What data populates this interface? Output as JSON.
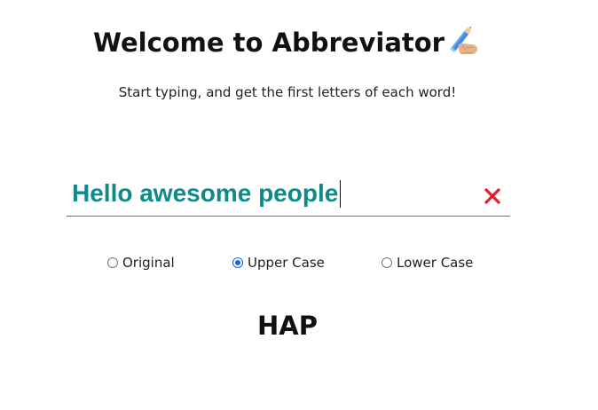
{
  "header": {
    "title": "Welcome to Abbreviator",
    "title_icon": "writing-hand-icon",
    "subtitle": "Start typing, and get the first letters of each word!"
  },
  "input": {
    "value": "Hello awesome people",
    "clear_icon": "close-icon",
    "text_color": "#0e8a8a",
    "clear_color": "#e8192c"
  },
  "case_options": {
    "selected": "Upper Case",
    "items": [
      {
        "label": "Original",
        "checked": false
      },
      {
        "label": "Upper Case",
        "checked": true
      },
      {
        "label": "Lower Case",
        "checked": false
      }
    ]
  },
  "result": {
    "text": "HAP"
  },
  "colors": {
    "accent": "#1a5fe0",
    "underline": "#2f8a8a"
  }
}
